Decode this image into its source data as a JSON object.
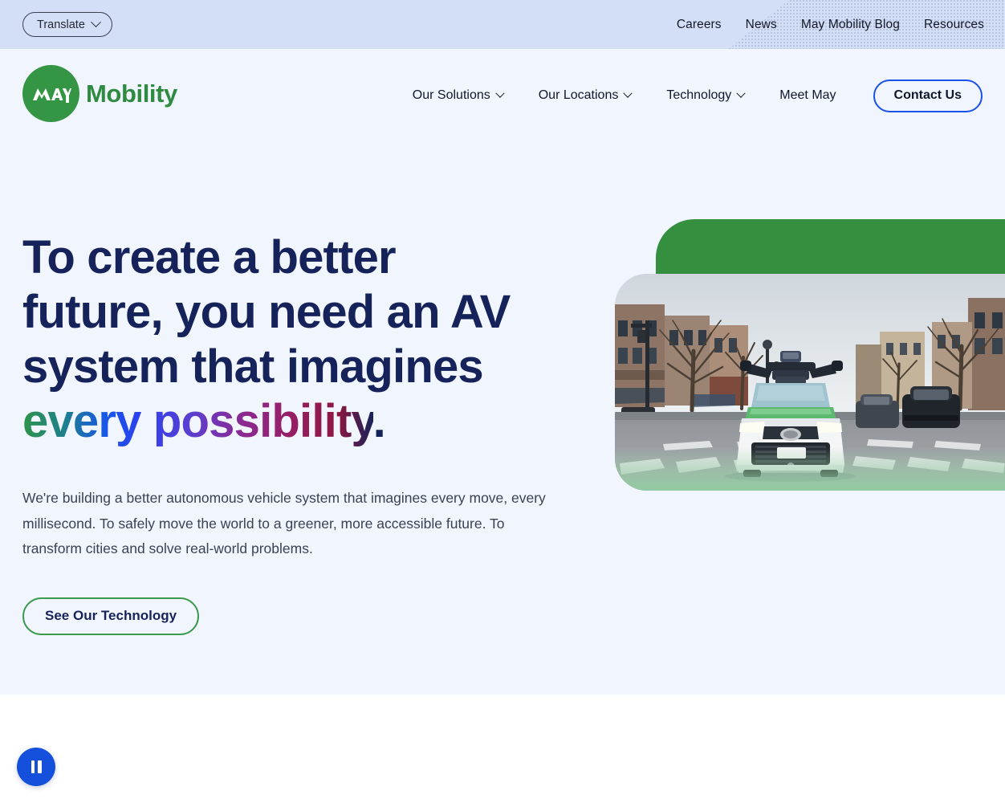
{
  "utility_bar": {
    "translate_label": "Translate",
    "translate_icon": "chevron-down-icon",
    "links": [
      {
        "label": "Careers"
      },
      {
        "label": "News"
      },
      {
        "label": "May Mobility Blog"
      },
      {
        "label": "Resources"
      }
    ],
    "background_color": "#d3dff7"
  },
  "header": {
    "logo": {
      "mark_text": "MAY",
      "word_text": "Mobility",
      "brand_green": "#349544"
    },
    "nav": [
      {
        "label": "Our Solutions",
        "has_dropdown": true
      },
      {
        "label": "Our Locations",
        "has_dropdown": true
      },
      {
        "label": "Technology",
        "has_dropdown": true
      },
      {
        "label": "Meet May",
        "has_dropdown": false
      }
    ],
    "contact_label": "Contact Us",
    "contact_border_color": "#1a52e8",
    "background_color": "#f1f5fe"
  },
  "hero": {
    "title_line_1": "To create a better",
    "title_line_2": "future, you need an AV",
    "title_line_3": "system that imagines",
    "title_gradient_text": "every possibility",
    "title_period": ".",
    "title_color": "#16235a",
    "body": "We're building a better autonomous vehicle system that imagines every move, every millisecond. To safely move the world to a greener, more accessible future. To transform cities and solve real-world problems.",
    "cta_label": "See Our Technology",
    "cta_border_color": "#3c9a4e",
    "background_color": "#f1f5fe",
    "media": {
      "green_panel_color": "#34903f",
      "photo_alt": "White May Mobility Toyota Sienna autonomous vehicle with roof-mounted lidar sensors driving through a downtown crosswalk"
    }
  },
  "media_controls": {
    "pause_label": "Pause",
    "icon": "pause-icon",
    "color": "#1550dd"
  }
}
